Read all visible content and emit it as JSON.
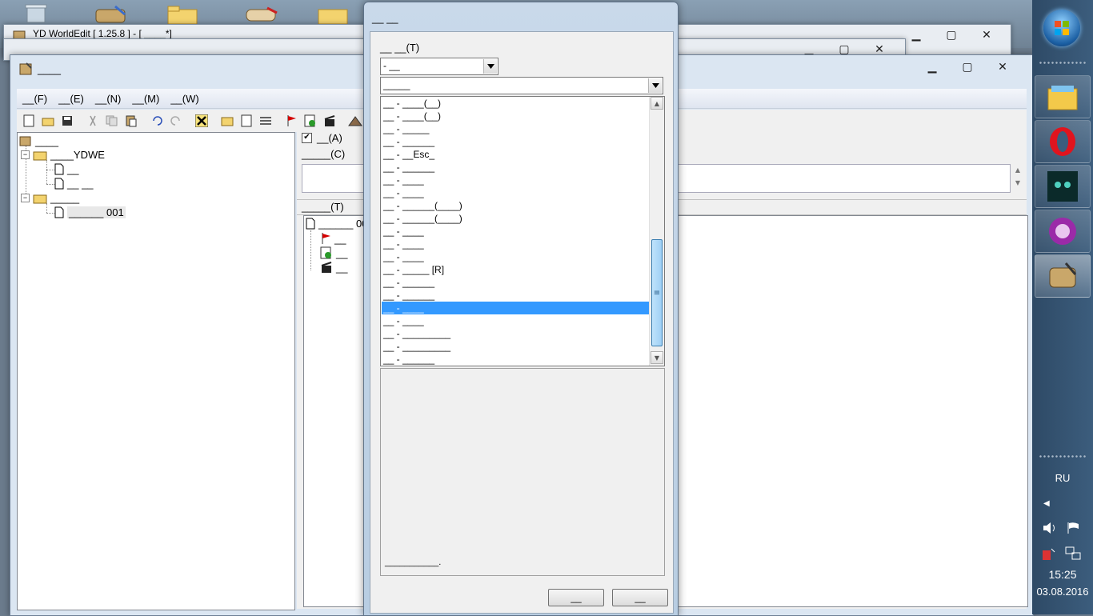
{
  "background_window": {
    "title": "YD WorldEdit [ 1.25.8 ] - [ ____*]"
  },
  "main_window": {
    "title": "____",
    "menu": [
      "__(F)",
      "__(E)",
      "__(N)",
      "__(M)",
      "__(W)"
    ],
    "tree": {
      "root": "____",
      "folder1": "____YDWE",
      "folder1_items": [
        "__",
        "__ __"
      ],
      "folder2": "_____",
      "folder2_items": [
        "______ 001"
      ]
    },
    "right_panel": {
      "check_a": "__(A)",
      "label_c": "_____(C)",
      "label_t": "_____(T)",
      "trigger_root": "______ 001",
      "trigger_items": [
        "__",
        "__",
        "__"
      ]
    }
  },
  "dialog": {
    "title": "__ __",
    "label": "__ __(T)",
    "combo1": "- __",
    "combo2": "_____",
    "list": [
      "__ - ____(__)",
      "__ - ____(__)",
      "__ - _____",
      "__ - ______",
      "__ - __Esc_",
      "__ - ______",
      "__ - ____",
      "__ - ____",
      "__ - ______(____)",
      "__ - ______(____)",
      "__ - ____",
      "__ - ____",
      "__ - ____",
      "__ - _____ [R]",
      "__ - ______",
      "__ - ______",
      "__ - ____",
      "__ - ____",
      "__ - _________",
      "__ - _________",
      "__ - ______"
    ],
    "selected_index": 16,
    "description": "___________.",
    "ok_label": "__",
    "cancel_label": "__"
  },
  "taskbar": {
    "language": "RU",
    "time": "15:25",
    "date": "03.08.2016"
  },
  "colors": {
    "selection": "#3399ff",
    "taskbar": "#2e4a66"
  }
}
